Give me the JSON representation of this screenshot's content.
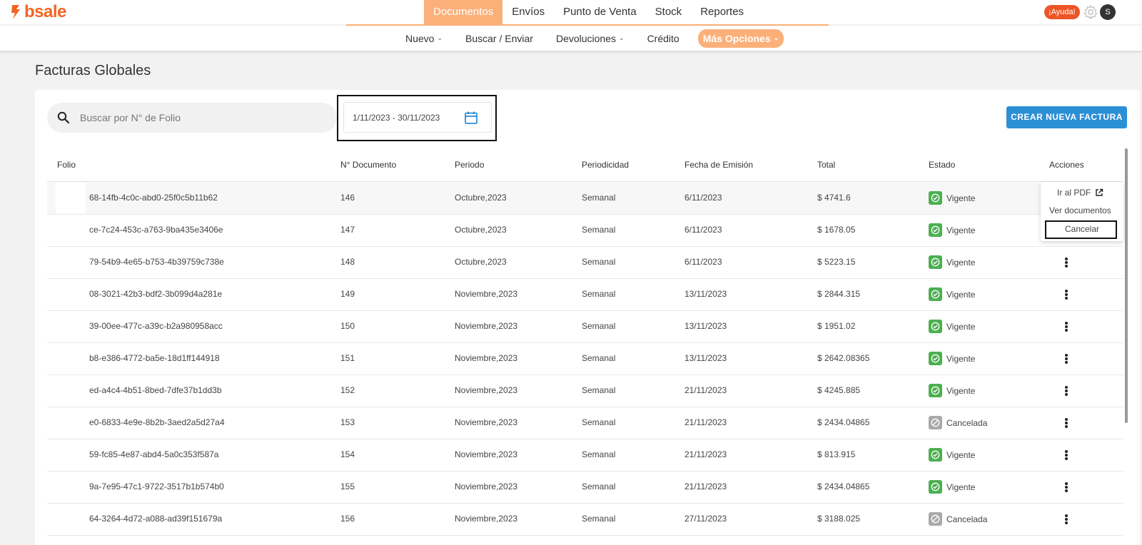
{
  "app": {
    "logo_text": "bsale",
    "brand_color": "#f26522",
    "accent_color": "#fbb07a"
  },
  "top_nav": {
    "items": [
      {
        "label": "Documentos",
        "active": true
      },
      {
        "label": "Envíos"
      },
      {
        "label": "Punto de Venta"
      },
      {
        "label": "Stock"
      },
      {
        "label": "Reportes"
      }
    ],
    "help_label": "¡Ayuda!",
    "avatar_initial": "S"
  },
  "sub_nav": {
    "items": [
      {
        "label": "Nuevo",
        "has_dropdown": true
      },
      {
        "label": "Buscar / Enviar"
      },
      {
        "label": "Devoluciones",
        "has_dropdown": true
      },
      {
        "label": "Crédito"
      },
      {
        "label": "Más Opciones",
        "has_dropdown": true,
        "highlighted": true
      }
    ]
  },
  "page": {
    "title": "Facturas Globales"
  },
  "search": {
    "placeholder": "Buscar por N° de Folio",
    "value": ""
  },
  "date_range": {
    "value": "1/11/2023 - 30/11/2023"
  },
  "create_button": {
    "label": "CREAR NUEVA FACTURA"
  },
  "table": {
    "headers": [
      "Folio",
      "N° Documento",
      "Periodo",
      "Periodicidad",
      "Fecha de Emisión",
      "Total",
      "Estado",
      "Acciones"
    ],
    "rows": [
      {
        "folio": "68-14fb-4c0c-abd0-25f0c5b11b62",
        "doc": "146",
        "periodo": "Octubre,2023",
        "periodicidad": "Semanal",
        "fecha": "6/11/2023",
        "total": "$ 4741.6",
        "estado": "Vigente"
      },
      {
        "folio": "ce-7c24-453c-a763-9ba435e3406e",
        "doc": "147",
        "periodo": "Octubre,2023",
        "periodicidad": "Semanal",
        "fecha": "6/11/2023",
        "total": "$ 1678.05",
        "estado": "Vigente"
      },
      {
        "folio": "79-54b9-4e65-b753-4b39759c738e",
        "doc": "148",
        "periodo": "Octubre,2023",
        "periodicidad": "Semanal",
        "fecha": "6/11/2023",
        "total": "$ 5223.15",
        "estado": "Vigente"
      },
      {
        "folio": "08-3021-42b3-bdf2-3b099d4a281e",
        "doc": "149",
        "periodo": "Noviembre,2023",
        "periodicidad": "Semanal",
        "fecha": "13/11/2023",
        "total": "$ 2844.315",
        "estado": "Vigente"
      },
      {
        "folio": "39-00ee-477c-a39c-b2a980958acc",
        "doc": "150",
        "periodo": "Noviembre,2023",
        "periodicidad": "Semanal",
        "fecha": "13/11/2023",
        "total": "$ 1951.02",
        "estado": "Vigente"
      },
      {
        "folio": "b8-e386-4772-ba5e-18d1ff144918",
        "doc": "151",
        "periodo": "Noviembre,2023",
        "periodicidad": "Semanal",
        "fecha": "13/11/2023",
        "total": "$ 2642.08365",
        "estado": "Vigente"
      },
      {
        "folio": "ed-a4c4-4b51-8bed-7dfe37b1dd3b",
        "doc": "152",
        "periodo": "Noviembre,2023",
        "periodicidad": "Semanal",
        "fecha": "21/11/2023",
        "total": "$ 4245.885",
        "estado": "Vigente"
      },
      {
        "folio": "e0-6833-4e9e-8b2b-3aed2a5d27a4",
        "doc": "153",
        "periodo": "Noviembre,2023",
        "periodicidad": "Semanal",
        "fecha": "21/11/2023",
        "total": "$ 2434.04865",
        "estado": "Cancelada"
      },
      {
        "folio": "59-fc85-4e87-abd4-5a0c353f587a",
        "doc": "154",
        "periodo": "Noviembre,2023",
        "periodicidad": "Semanal",
        "fecha": "21/11/2023",
        "total": "$ 813.915",
        "estado": "Vigente"
      },
      {
        "folio": "9a-7e95-47c1-9722-3517b1b574b0",
        "doc": "155",
        "periodo": "Noviembre,2023",
        "periodicidad": "Semanal",
        "fecha": "21/11/2023",
        "total": "$ 2434.04865",
        "estado": "Vigente"
      },
      {
        "folio": "64-3264-4d72-a088-ad39f151679a",
        "doc": "156",
        "periodo": "Noviembre,2023",
        "periodicidad": "Semanal",
        "fecha": "27/11/2023",
        "total": "$ 3188.025",
        "estado": "Cancelada"
      }
    ]
  },
  "actions_menu": {
    "items": [
      "Ir al PDF",
      "Ver documentos",
      "Cancelar"
    ]
  },
  "status_colors": {
    "Vigente": "#4caf50",
    "Cancelada": "#a9a9a9"
  }
}
